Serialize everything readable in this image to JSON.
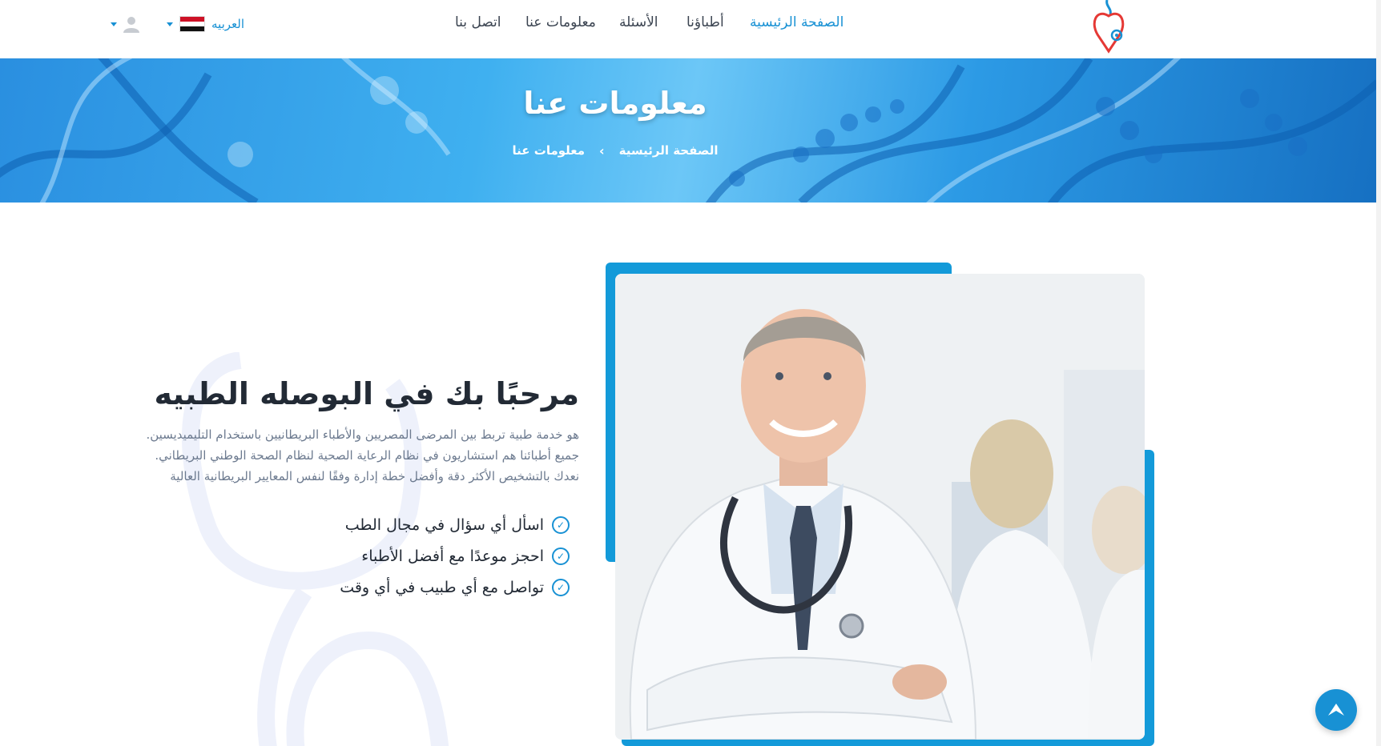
{
  "header": {
    "nav": [
      {
        "label": "الصفحة الرئيسية",
        "active": true
      },
      {
        "label": "أطباؤنا",
        "active": false
      },
      {
        "label": "الأسئلة",
        "active": false
      },
      {
        "label": "معلومات عنا",
        "active": false
      },
      {
        "label": "اتصل بنا",
        "active": false
      }
    ],
    "language": {
      "label": "العربيه",
      "flag_icon": "egypt-flag-icon"
    },
    "user_icon": "user-icon"
  },
  "banner": {
    "title": "معلومات عنا",
    "breadcrumb": {
      "home": "الصفحة الرئيسية",
      "separator": "›",
      "current": "معلومات عنا"
    }
  },
  "about": {
    "heading": "مرحبًا بك في البوصله الطبيه",
    "description": "هو خدمة طبية تربط بين المرضى المصريين والأطباء البريطانيين باستخدام التليميديسين. جميع أطبائنا هم استشاريون في نظام الرعاية الصحية لنظام الصحة الوطني البريطاني. نعدك بالتشخيص الأكثر دقة وأفضل خطة إدارة وفقًا لنفس المعايير البريطانية العالية",
    "features": [
      "اسأل أي سؤال في مجال الطب",
      "احجز موعدًا مع أفضل الأطباء",
      "تواصل مع أي طبيب في أي وقت"
    ]
  },
  "colors": {
    "accent": "#1891d4",
    "frame": "#139ad9",
    "logo": "#e53935"
  }
}
